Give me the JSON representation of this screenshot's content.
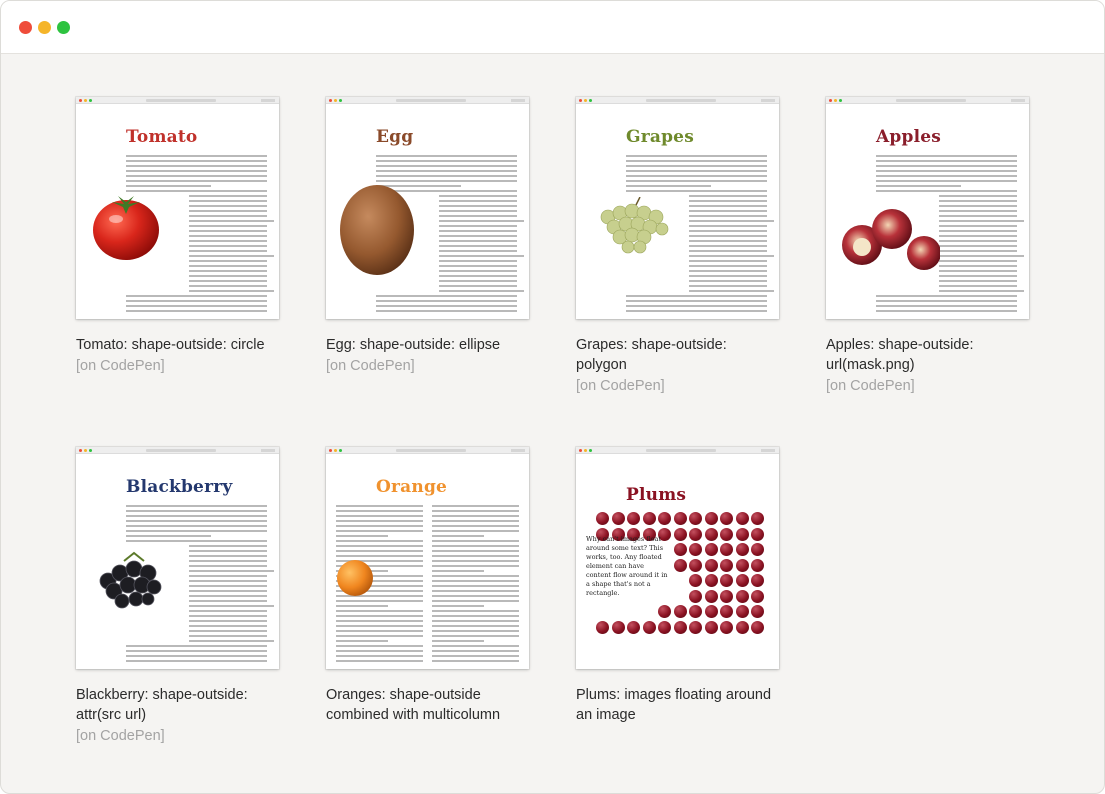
{
  "window": {
    "traffic_lights": [
      "close",
      "minimize",
      "zoom"
    ]
  },
  "cards": [
    {
      "title": "Tomato",
      "title_color": "#c0312b",
      "caption": "Tomato: shape-outside: circle",
      "link": "[on CodePen]",
      "icon": "tomato-icon"
    },
    {
      "title": "Egg",
      "title_color": "#8a4a2a",
      "caption": "Egg: shape-outside: ellipse",
      "link": "[on CodePen]",
      "icon": "egg-icon"
    },
    {
      "title": "Grapes",
      "title_color": "#6f8a2c",
      "caption": "Grapes: shape-outside: polygon",
      "link": "[on CodePen]",
      "icon": "grapes-icon"
    },
    {
      "title": "Apples",
      "title_color": "#8a1e2b",
      "caption": "Apples: shape-outside: url(mask.png)",
      "link": "[on CodePen]",
      "icon": "apples-icon"
    },
    {
      "title": "Blackberry",
      "title_color": "#24386e",
      "caption": "Blackberry: shape-outside: attr(src url)",
      "link": "[on CodePen]",
      "icon": "blackberry-icon"
    },
    {
      "title": "Orange",
      "title_color": "#f0922e",
      "caption": "Oranges: shape-outside combined with multicolumn",
      "link": "",
      "icon": "orange-icon"
    },
    {
      "title": "Plums",
      "title_color": "#8a1222",
      "caption": "Plums: images floating around an image",
      "link": "",
      "icon": "plum-icon",
      "body_text": "Why can't images float around some text? This works, too. Any floated element can have content flow around it in a shape that's not a rectangle."
    }
  ]
}
